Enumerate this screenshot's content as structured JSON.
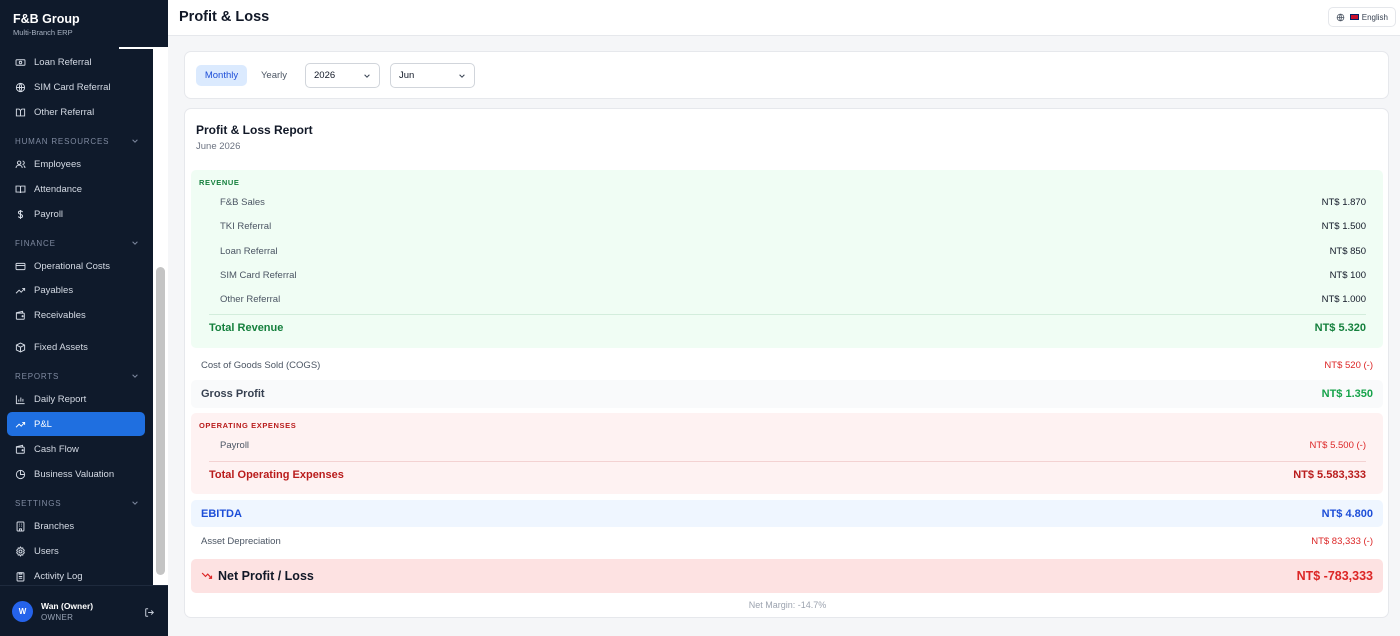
{
  "brand": {
    "title": "F&B Group",
    "subtitle": "Multi-Branch ERP"
  },
  "sidebar": {
    "items_top": [
      {
        "label": "Loan Referral",
        "icon": "banknote-icon"
      },
      {
        "label": "SIM Card Referral",
        "icon": "globe-icon"
      },
      {
        "label": "Other Referral",
        "icon": "book-icon"
      }
    ],
    "sections": {
      "hr": "HUMAN RESOURCES",
      "finance": "FINANCE",
      "reports": "REPORTS",
      "settings": "SETTINGS"
    },
    "hr_items": [
      {
        "label": "Employees",
        "icon": "users-icon"
      },
      {
        "label": "Attendance",
        "icon": "book-open-icon"
      },
      {
        "label": "Payroll",
        "icon": "dollar-icon"
      }
    ],
    "finance_items": [
      {
        "label": "Operational Costs",
        "icon": "credit-card-icon"
      },
      {
        "label": "Payables",
        "icon": "trending-up-icon"
      },
      {
        "label": "Receivables",
        "icon": "wallet-icon"
      },
      {
        "label": "Fixed Assets",
        "icon": "box-icon"
      }
    ],
    "report_items": [
      {
        "label": "Daily Report",
        "icon": "bar-chart-icon"
      },
      {
        "label": "P&L",
        "icon": "trending-up-icon",
        "active": true
      },
      {
        "label": "Cash Flow",
        "icon": "wallet-icon"
      },
      {
        "label": "Business Valuation",
        "icon": "pie-chart-icon"
      }
    ],
    "settings_items": [
      {
        "label": "Branches",
        "icon": "building-icon"
      },
      {
        "label": "Users",
        "icon": "gear-icon"
      },
      {
        "label": "Activity Log",
        "icon": "clipboard-icon"
      }
    ]
  },
  "user": {
    "initial": "W",
    "name": "Wan (Owner)",
    "role": "OWNER"
  },
  "header": {
    "title": "Profit & Loss",
    "language": "English"
  },
  "filters": {
    "monthly": "Monthly",
    "yearly": "Yearly",
    "year": "2026",
    "month": "Jun"
  },
  "report": {
    "title": "Profit & Loss Report",
    "period": "June 2026",
    "revenue": {
      "label": "REVENUE",
      "items": [
        {
          "label": "F&B Sales",
          "amount": "NT$ 1.870"
        },
        {
          "label": "TKI Referral",
          "amount": "NT$ 1.500"
        },
        {
          "label": "Loan Referral",
          "amount": "NT$ 850"
        },
        {
          "label": "SIM Card Referral",
          "amount": "NT$ 100"
        },
        {
          "label": "Other Referral",
          "amount": "NT$ 1.000"
        }
      ],
      "total_label": "Total Revenue",
      "total_amount": "NT$ 5.320"
    },
    "cogs": {
      "label": "Cost of Goods Sold (COGS)",
      "amount": "NT$ 520 (-)"
    },
    "gross": {
      "label": "Gross Profit",
      "amount": "NT$ 1.350"
    },
    "opex": {
      "label": "OPERATING EXPENSES",
      "items": [
        {
          "label": "Payroll",
          "amount": "NT$ 5.500 (-)"
        }
      ],
      "total_label": "Total Operating Expenses",
      "total_amount": "NT$ 5.583,333"
    },
    "ebitda": {
      "label": "EBITDA",
      "amount": "NT$ 4.800"
    },
    "depreciation": {
      "label": "Asset Depreciation",
      "amount": "NT$ 83,333 (-)"
    },
    "net": {
      "label": "Net Profit / Loss",
      "amount": "NT$ -783,333"
    },
    "margin": "Net Margin: -14.7%"
  },
  "colors": {
    "sidebar_bg": "#0f1a2b",
    "active": "#1f6fe0",
    "revenue_bg": "#f0fdf4",
    "expense_bg": "#fef2f2",
    "net_loss_bg": "#fde2e2"
  }
}
